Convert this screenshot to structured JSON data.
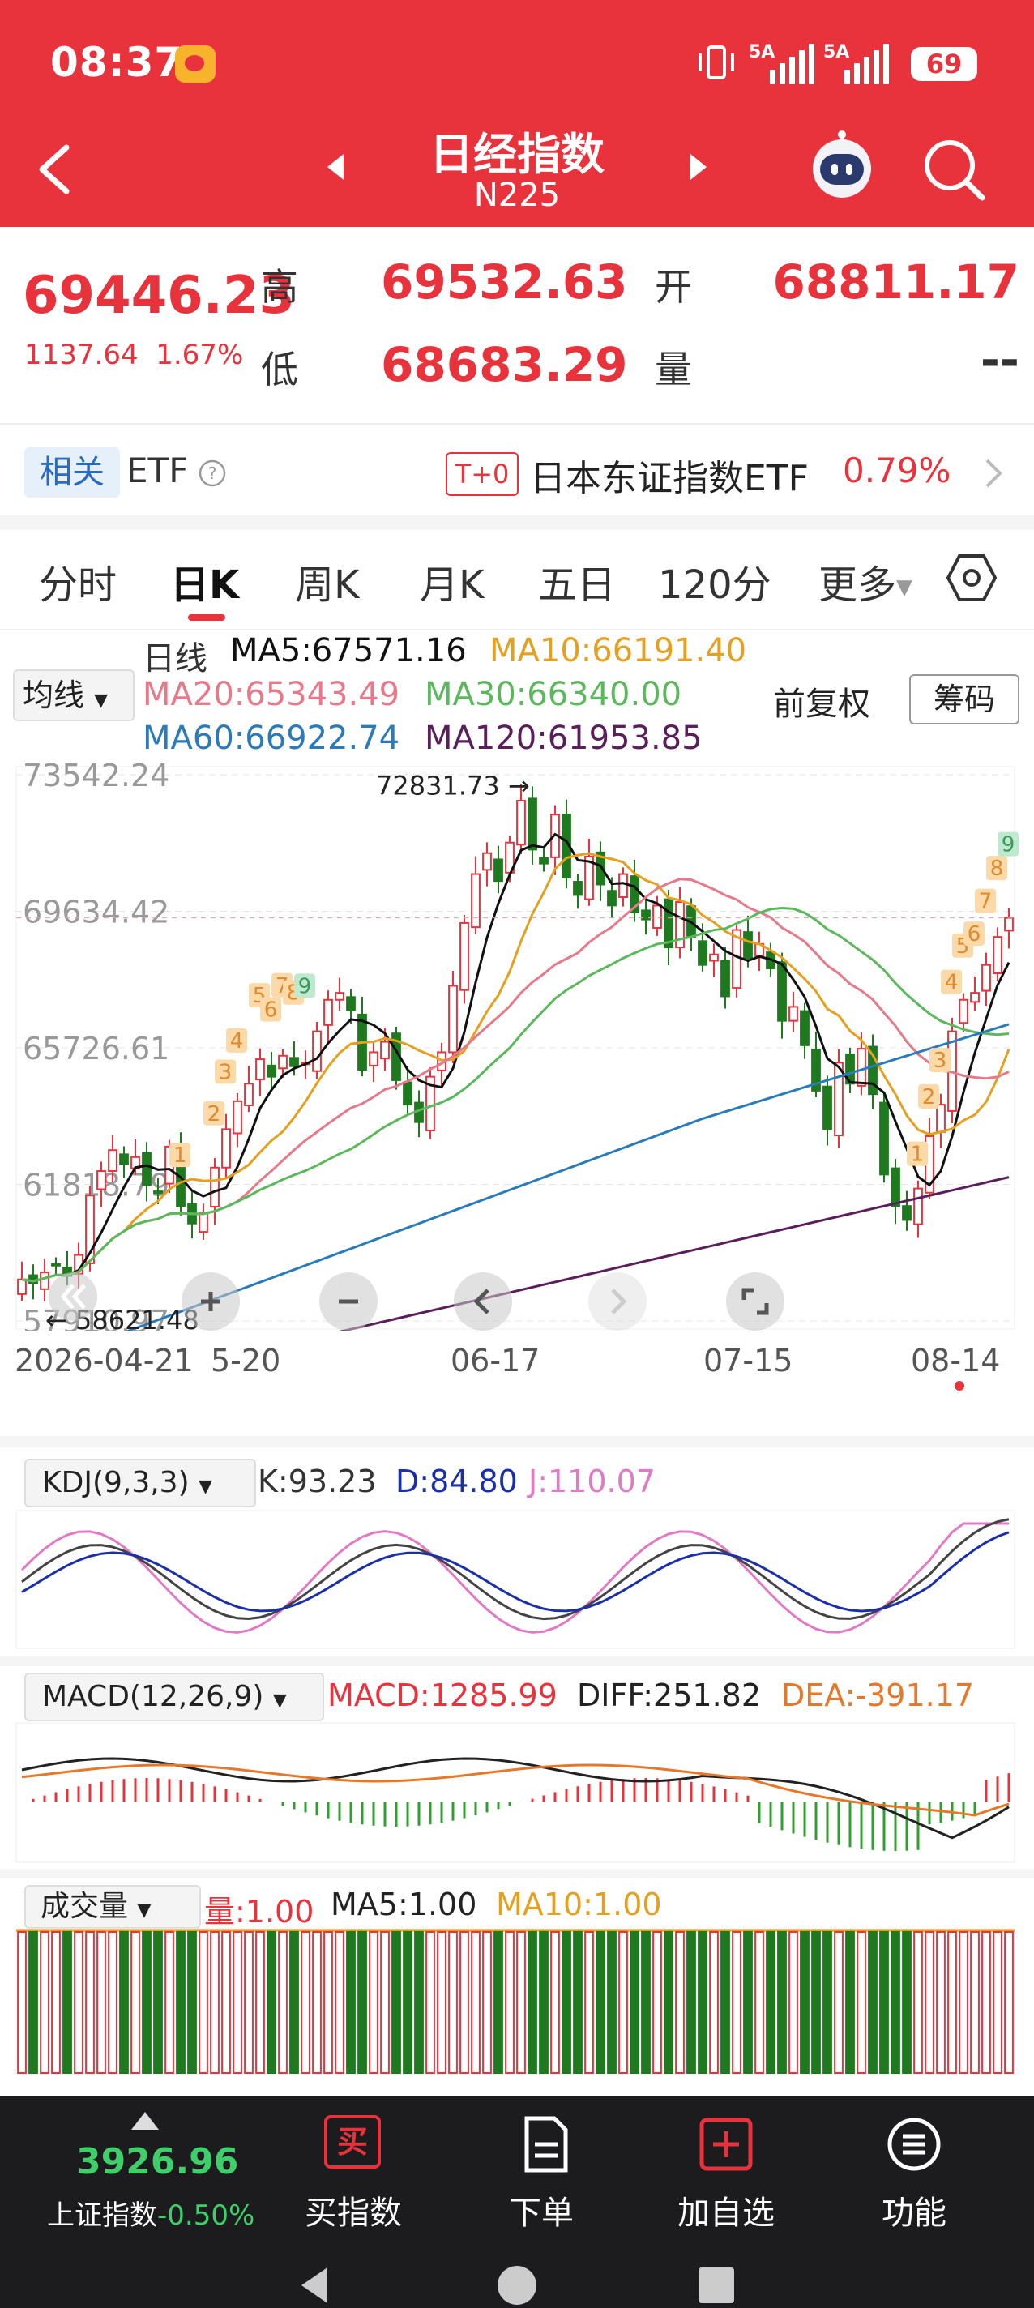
{
  "status": {
    "time": "08:37",
    "signal1": "5A",
    "signal2": "5A",
    "battery": "69"
  },
  "header": {
    "title": "日经指数",
    "subtitle": "N225"
  },
  "quote": {
    "price": "69446.23",
    "change": "1137.64",
    "change_pct": "1.67%",
    "high_label": "高",
    "high": "69532.63",
    "open_label": "开",
    "open": "68811.17",
    "low_label": "低",
    "low": "68683.29",
    "vol_label": "量",
    "vol": "--"
  },
  "etf": {
    "tag": "相关",
    "label": "ETF",
    "t0": "T+0",
    "name": "日本东证指数ETF",
    "pct": "0.79%"
  },
  "tabs": [
    "分时",
    "日K",
    "周K",
    "月K",
    "五日",
    "120分",
    "更多"
  ],
  "legend": {
    "mode": "均线",
    "period": "日线",
    "ma5": "MA5:67571.16",
    "ma10": "MA10:66191.40",
    "ma20": "MA20:65343.49",
    "ma30": "MA30:66340.00",
    "ma60": "MA60:66922.74",
    "ma120": "MA120:61953.85",
    "adjust": "前复权",
    "chips": "筹码"
  },
  "colors": {
    "up": "#e8323c",
    "down": "#1f7a1f",
    "ma5": "#111111",
    "ma10": "#e6a020",
    "ma20": "#e67a8a",
    "ma30": "#5cb85c",
    "ma60": "#2b7bb9",
    "ma120": "#5a1f5a"
  },
  "chart_data": {
    "type": "candlestick",
    "y_ticks": [
      "73542.24",
      "69634.42",
      "65726.61",
      "61818.79",
      "57910.97"
    ],
    "x_ticks": [
      "2026-04-21",
      "5-20",
      "06-17",
      "07-15",
      "08-14"
    ],
    "max_label": "72831.73",
    "min_label": "58621.48",
    "ylim": [
      57910.97,
      73542.24
    ],
    "closes": [
      59100,
      59000,
      59300,
      59500,
      59200,
      59800,
      61500,
      62200,
      62800,
      62400,
      62600,
      61800,
      61600,
      62900,
      61200,
      60700,
      61000,
      62300,
      63400,
      64200,
      64700,
      65400,
      64900,
      65500,
      65200,
      65300,
      66200,
      67100,
      67300,
      66800,
      65100,
      65600,
      65900,
      64800,
      64100,
      63600,
      64900,
      65600,
      67500,
      69300,
      70700,
      71300,
      70500,
      71600,
      72800,
      71400,
      71000,
      72400,
      70600,
      70100,
      71200,
      70400,
      69800,
      70700,
      69600,
      69400,
      69800,
      68600,
      69900,
      68900,
      68100,
      68400,
      67200,
      69100,
      68300,
      68700,
      68000,
      66500,
      66900,
      65800,
      64500,
      63400,
      65300,
      64700,
      65700,
      64400,
      62100,
      61200,
      60800,
      61700,
      63200,
      64100,
      66200,
      67100,
      67300,
      68100,
      68900,
      69446
    ],
    "tail_labels": [
      "1",
      "2",
      "3",
      "4",
      "5",
      "6",
      "7",
      "8",
      "9"
    ],
    "early_labels": [
      "1",
      "2",
      "3",
      "4",
      "5",
      "6",
      "7",
      "8",
      "9"
    ]
  },
  "kdj": {
    "name": "KDJ(9,3,3)",
    "k": "K:93.23",
    "d": "D:84.80",
    "j": "J:110.07"
  },
  "macd": {
    "name": "MACD(12,26,9)",
    "macd": "MACD:1285.99",
    "diff": "DIFF:251.82",
    "dea": "DEA:-391.17"
  },
  "volume": {
    "name": "成交量",
    "vol": "量:1.00",
    "ma5": "MA5:1.00",
    "ma10": "MA10:1.00"
  },
  "bottom": {
    "index_value": "3926.96",
    "index_name": "上证指数",
    "index_pct": "-0.50%",
    "buy": "买指数",
    "sell": "下单",
    "add": "加自选",
    "func": "功能",
    "buy_icon": "买"
  }
}
